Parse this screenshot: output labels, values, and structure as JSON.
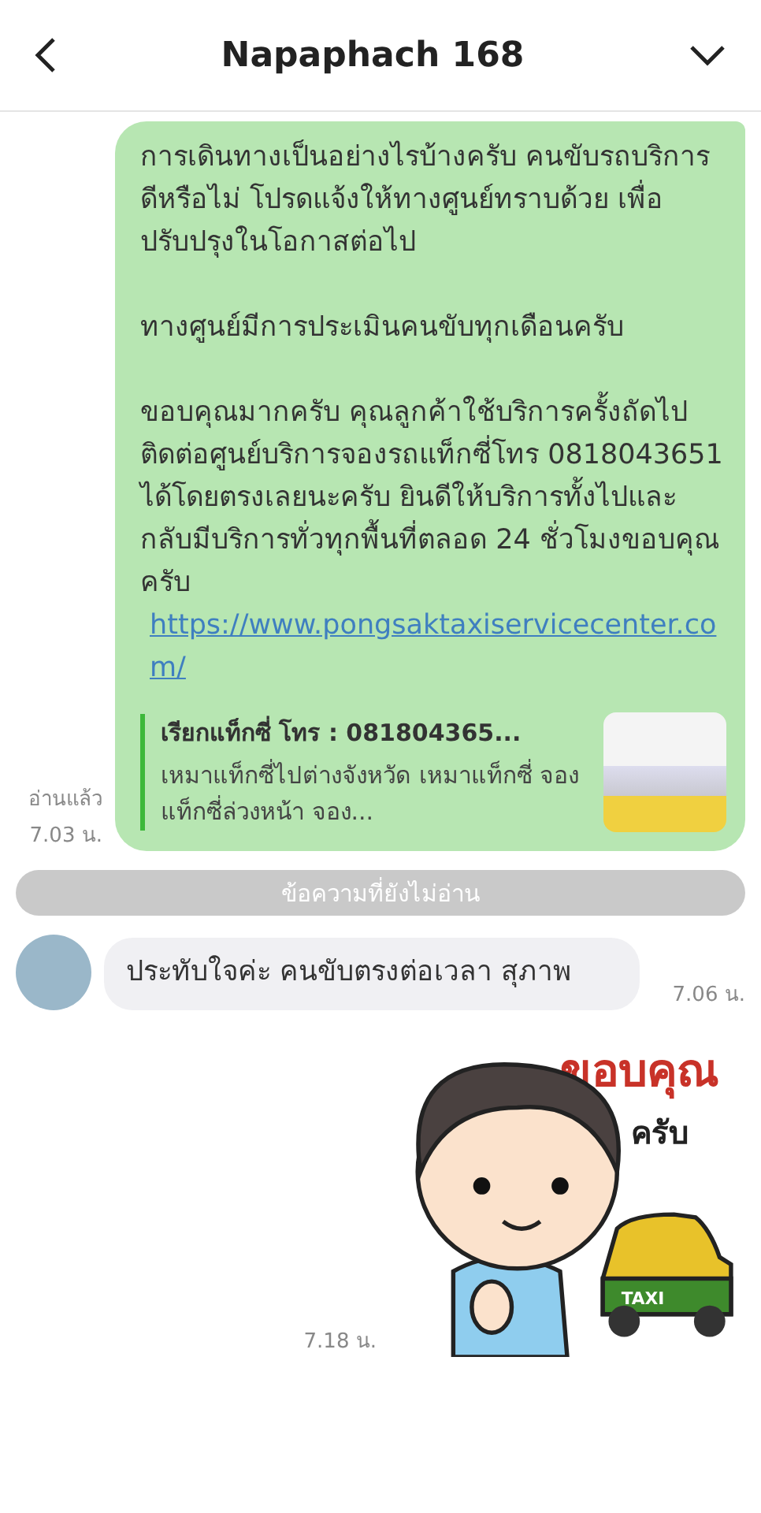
{
  "header": {
    "title": "Napaphach 168"
  },
  "messages": [
    {
      "kind": "outgoing",
      "read_label": "อ่านแล้ว",
      "time": "7.03 น.",
      "paragraphs": [
        "การเดินทางเป็นอย่างไรบ้างครับ คนขับรถบริการดีหรือไม่ โปรดแจ้งให้ทางศูนย์ทราบด้วย เพื่อปรับปรุงในโอกาสต่อไป",
        "ทางศูนย์มีการประเมินคนขับทุกเดือนครับ",
        "ขอบคุณมากครับ คุณลูกค้าใช้บริการครั้งถัดไป ติดต่อศูนย์บริการจองรถแท็กซี่โทร 0818043651 ได้โดยตรงเลยนะครับ ยินดีให้บริการทั้งไปและกลับมีบริการทั่วทุกพื้นที่ตลอด 24 ชั่วโมงขอบคุณครับ"
      ],
      "link": "https://www.pongsaktaxiservicecenter.com/",
      "preview": {
        "title": "เรียกแท็กซี่ โทร : 081804365...",
        "description": "เหมาแท็กซี่ไปต่างจังหวัด เหมาแท็กซี่ จองแท็กซี่ล่วงหน้า จอง..."
      }
    },
    {
      "kind": "divider",
      "text": "ข้อความที่ยังไม่อ่าน"
    },
    {
      "kind": "incoming",
      "text": "ประทับใจค่ะ คนขับตรงต่อเวลา สุภาพ",
      "time": "7.06 น."
    },
    {
      "kind": "sticker",
      "time": "7.18 น.",
      "texts": [
        "ขอบคุณ",
        "ครับ",
        "TAXI"
      ]
    }
  ]
}
